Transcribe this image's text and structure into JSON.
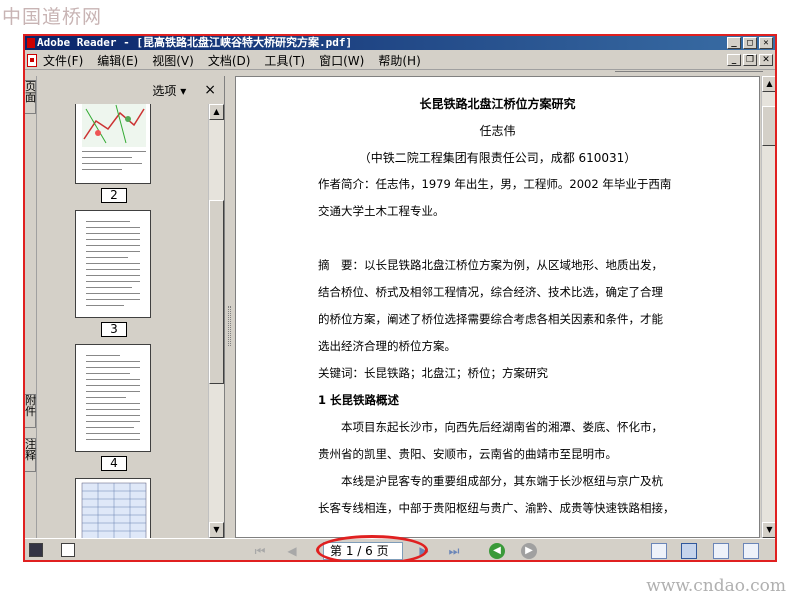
{
  "watermarks": {
    "top": "中国道桥网",
    "bottom": "www.cndao.com"
  },
  "window": {
    "title": "Adobe Reader - [昆高铁路北盘江峡谷特大桥研究方案.pdf]",
    "controls": {
      "minimize": "_",
      "maximize": "□",
      "close": "✕"
    }
  },
  "menubar": {
    "items": [
      "文件(F)",
      "编辑(E)",
      "视图(V)",
      "文档(D)",
      "工具(T)",
      "窗口(W)",
      "帮助(H)"
    ],
    "doc_controls": {
      "minimize": "_",
      "restore": "❐",
      "close": "✕"
    }
  },
  "left_tabs": {
    "pages": "页面",
    "attachments": "附件",
    "comments": "注释"
  },
  "nav_panel": {
    "options_label": "选项 ▾",
    "close_label": "×",
    "thumbnails": [
      {
        "label": "2"
      },
      {
        "label": "3"
      },
      {
        "label": "4"
      }
    ]
  },
  "document": {
    "title": "长昆铁路北盘江桥位方案研究",
    "author": "任志伟",
    "affiliation": "（中铁二院工程集团有限责任公司，成都 610031）",
    "paragraphs": [
      "作者简介：任志伟，1979 年出生，男，工程师。2002 年毕业于西南",
      "交通大学土木工程专业。",
      "摘　要：以长昆铁路北盘江桥位方案为例，从区域地形、地质出发，",
      "结合桥位、桥式及相邻工程情况，综合经济、技术比选，确定了合理",
      "的桥位方案，阐述了桥位选择需要综合考虑各相关因素和条件，才能",
      "选出经济合理的桥位方案。",
      "关键词：长昆铁路；北盘江；桥位；方案研究",
      "1 长昆铁路概述",
      "　　本项目东起长沙市，向西先后经湖南省的湘潭、娄底、怀化市，",
      "贵州省的凯里、贵阳、安顺市，云南省的曲靖市至昆明市。",
      "　　本线是沪昆客专的重要组成部分，其东端于长沙枢纽与京广及杭",
      "长客专线相连，中部于贵阳枢纽与贵广、渝黔、成贵等快速铁路相接，"
    ]
  },
  "bottombar": {
    "page_field": "第 1 / 6 页",
    "nav": {
      "first": "⏮",
      "prev": "◀",
      "next": "▶",
      "last": "⏭"
    },
    "history": {
      "back": "◀",
      "forward": "▶"
    }
  },
  "colors": {
    "annotation_red": "#e02020",
    "titlebar": "#0a246a",
    "chrome": "#d4d0c8"
  }
}
